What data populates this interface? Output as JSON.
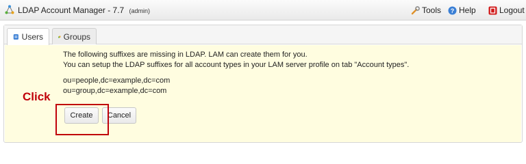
{
  "header": {
    "title": "LDAP Account Manager - 7.7",
    "user": "(admin)",
    "links": {
      "tools": "Tools",
      "help": "Help",
      "logout": "Logout"
    }
  },
  "tabs": [
    {
      "label": "Users",
      "icon": "users-icon"
    },
    {
      "label": "Groups",
      "icon": "groups-icon"
    }
  ],
  "main": {
    "message_line1": "The following suffixes are missing in LDAP. LAM can create them for you.",
    "message_line2": "You can setup the LDAP suffixes for all account types in your LAM server profile on tab \"Account types\".",
    "suffixes": [
      "ou=people,dc=example,dc=com",
      "ou=group,dc=example,dc=com"
    ],
    "create_label": "Create",
    "cancel_label": "Cancel"
  },
  "annotation": {
    "label": "Click",
    "color": "#c0000a"
  },
  "colors": {
    "content_background": "#fffde0",
    "logout_icon": "#d11a1a",
    "help_icon": "#3a7fd5"
  }
}
